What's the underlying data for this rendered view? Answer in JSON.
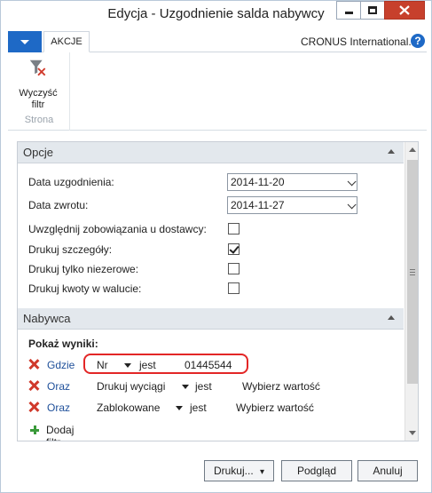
{
  "window": {
    "title": "Edycja - Uzgodnienie salda nabywcy"
  },
  "ribbon": {
    "tab_label": "AKCJE",
    "company": "CRONUS International...",
    "help_label": "?",
    "clear_filter_label_line1": "Wyczyść",
    "clear_filter_label_line2": "filtr",
    "group_label": "Strona"
  },
  "options": {
    "header": "Opcje",
    "fields": [
      {
        "label": "Data uzgodnienia:",
        "type": "date",
        "value": "2014-11-20"
      },
      {
        "label": "Data zwrotu:",
        "type": "date",
        "value": "2014-11-27"
      },
      {
        "label": "Uwzględnij zobowiązania u dostawcy:",
        "type": "checkbox",
        "checked": false
      },
      {
        "label": "Drukuj szczegóły:",
        "type": "checkbox",
        "checked": true
      },
      {
        "label": "Drukuj tylko niezerowe:",
        "type": "checkbox",
        "checked": false
      },
      {
        "label": "Drukuj kwoty w walucie:",
        "type": "checkbox",
        "checked": false
      }
    ]
  },
  "customer": {
    "header": "Nabywca",
    "show_results_label": "Pokaż wyniki:",
    "filters": [
      {
        "conjunction": "Gdzie",
        "field": "Nr",
        "operator": "jest",
        "value": "01445544"
      },
      {
        "conjunction": "Oraz",
        "field": "Drukuj wyciągi",
        "operator": "jest",
        "value": "Wybierz wartość"
      },
      {
        "conjunction": "Oraz",
        "field": "Zablokowane",
        "operator": "jest",
        "value": "Wybierz wartość"
      }
    ],
    "add_filter_label": "Dodaj filtr"
  },
  "buttons": {
    "print": "Drukuj...",
    "print_arrow": "▾",
    "preview": "Podgląd",
    "cancel": "Anuluj"
  },
  "colors": {
    "accent": "#1e69c6",
    "close_button": "#c7402c",
    "remove_filter": "#d0392b",
    "add_filter": "#3a9a3a",
    "highlight_ring": "#e32626"
  }
}
